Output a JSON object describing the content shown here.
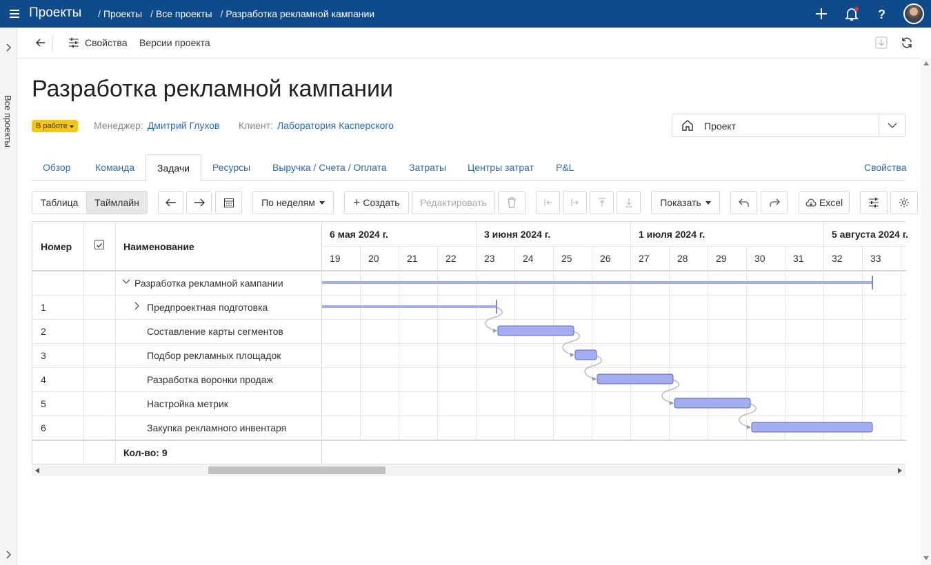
{
  "header": {
    "app_title": "Проекты",
    "breadcrumbs": [
      "Проекты",
      "Все проекты",
      "Разработка рекламной кампании"
    ],
    "has_notification": true
  },
  "left_rail": {
    "label": "Все проекты"
  },
  "toolbar": {
    "properties": "Свойства",
    "versions": "Версии проекта"
  },
  "page": {
    "title": "Разработка рекламной кампании",
    "status": "В работе",
    "manager_label": "Менеджер:",
    "manager": "Дмитрий Глухов",
    "client_label": "Клиент:",
    "client": "Лаборатория Касперского",
    "selector_value": "Проект"
  },
  "tabs": [
    "Обзор",
    "Команда",
    "Задачи",
    "Ресурсы",
    "Выручка / Счета / Оплата",
    "Затраты",
    "Центры затрат",
    "P&L"
  ],
  "active_tab": "Задачи",
  "tabs_right": "Свойства",
  "actions": {
    "table": "Таблица",
    "timeline": "Таймлайн",
    "period": "По неделям",
    "create": "Создать",
    "edit": "Редактировать",
    "show": "Показать",
    "excel": "Excel"
  },
  "grid": {
    "col_number": "Номер",
    "col_name": "Наименование",
    "months": [
      "6 мая 2024 г.",
      "3 июня 2024 г.",
      "1 июля 2024 г.",
      "5 августа 2024 г."
    ],
    "weeks": [
      "19",
      "20",
      "21",
      "22",
      "23",
      "24",
      "25",
      "26",
      "27",
      "28",
      "29",
      "30",
      "31",
      "32",
      "33"
    ],
    "rows": [
      {
        "num": "",
        "name": "Разработка рекламной кампании"
      },
      {
        "num": "1",
        "name": "Предпроектная подготовка"
      },
      {
        "num": "2",
        "name": "Составление карты сегментов"
      },
      {
        "num": "3",
        "name": "Подбор рекламных площадок"
      },
      {
        "num": "4",
        "name": "Разработка воронки продаж"
      },
      {
        "num": "5",
        "name": "Настройка метрик"
      },
      {
        "num": "6",
        "name": "Закупка рекламного инвентаря"
      }
    ],
    "footer": "Кол-во: 9"
  },
  "colors": {
    "topbar": "#0f4a8a",
    "link": "#2a6cb5",
    "bar": "#a3aef0",
    "bar_border": "#5a66c8",
    "badge": "#f5c518"
  },
  "icons": [
    "menu-icon",
    "plus-icon",
    "bell-icon",
    "help-icon",
    "back-arrow-icon",
    "settings-sliders-icon",
    "download-icon",
    "refresh-icon",
    "home-icon",
    "chevron-down-icon",
    "calendar-icon",
    "trash-icon",
    "undo-icon",
    "redo-icon",
    "cloud-icon",
    "gear-icon"
  ]
}
